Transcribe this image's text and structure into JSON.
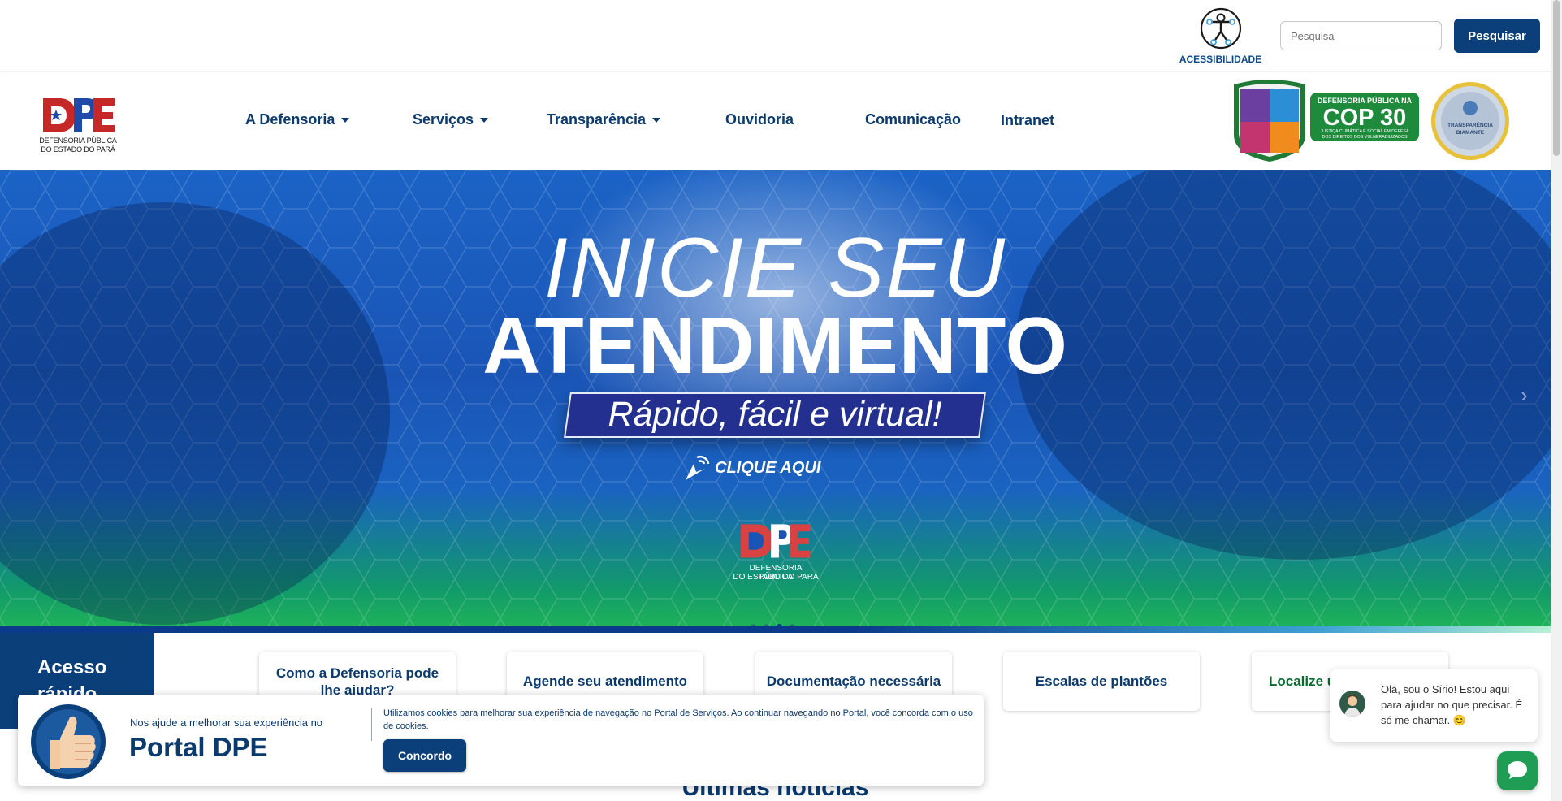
{
  "topbar": {
    "accessibility_label": "ACESSIBILIDADE",
    "search_placeholder": "Pesquisa",
    "search_button": "Pesquisar"
  },
  "logo": {
    "letters": "DPE",
    "line1": "DEFENSORIA PÚBLICA",
    "line2": "DO ESTADO DO PARÁ"
  },
  "nav": {
    "items": [
      {
        "label": "A Defensoria",
        "dropdown": true
      },
      {
        "label": "Serviços",
        "dropdown": true
      },
      {
        "label": "Transparência",
        "dropdown": true
      },
      {
        "label": "Ouvidoria",
        "dropdown": false
      },
      {
        "label": "Comunicação",
        "dropdown": false
      },
      {
        "label": "Intranet",
        "dropdown": false
      }
    ]
  },
  "badges": {
    "cop_line1": "DEFENSORIA PÚBLICA NA",
    "cop_main": "COP 30",
    "cop_line2": "JUSTIÇA CLIMÁTICA E SOCIAL EM DEFESA",
    "cop_line3": "DOS DIREITOS DOS VULNERABILIZADOS",
    "transparencia_line1": "TRANSPARÊNCIA",
    "transparencia_line2": "DIAMANTE"
  },
  "hero": {
    "line1": "INICIE SEU",
    "line2": "ATENDIMENTO",
    "line3": "Rápido, fácil e virtual!",
    "cta": "CLIQUE AQUI",
    "logo_line1": "DEFENSORIA PÚBLICA",
    "logo_line2": "DO ESTADO DO PARÁ",
    "slides_total": 4,
    "active_slide": 3
  },
  "quick_access": {
    "title": "Acesso rápido",
    "cards": [
      "Como a Defensoria pode lhe ajudar?",
      "Agende seu atendimento",
      "Documentação necessária",
      "Escalas de plantões",
      "Localize u"
    ]
  },
  "news": {
    "title": "Últimas notícias"
  },
  "cookie": {
    "help_text": "Nos ajude a melhorar sua experiência no",
    "portal": "Portal DPE",
    "message": "Utilizamos cookies para melhorar sua experiência de navegação no Portal de Serviços. Ao continuar navegando no Portal, você concorda com o uso de cookies.",
    "accept": "Concordo"
  },
  "chat": {
    "message": "Olá, sou o Sírio! Estou aqui para ajudar no que precisar. É só me chamar. 😊"
  },
  "colors": {
    "primary": "#0b3f79",
    "accent_green": "#1f9d55",
    "text_blue": "#0b3a6e"
  }
}
